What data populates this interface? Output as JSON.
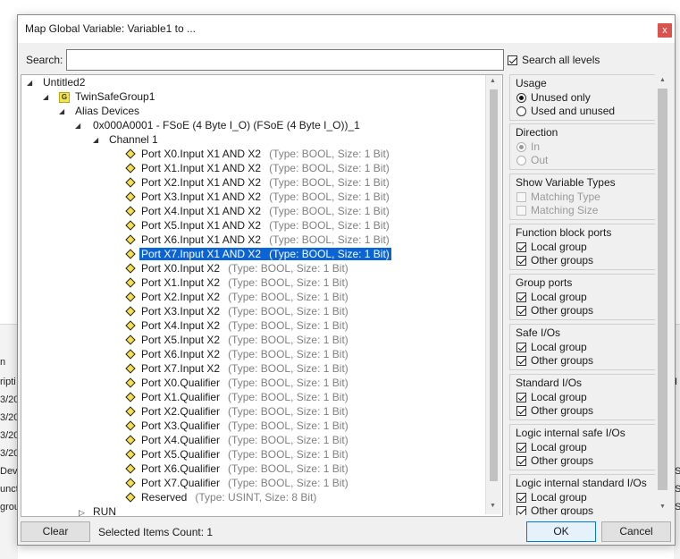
{
  "dialog": {
    "title": "Map Global Variable: Variable1 to ...",
    "close_glyph": "x",
    "search_label": "Search:",
    "search_value": "",
    "search_all_label": "Search all levels",
    "search_all_checked": true,
    "selected_count_label": "Selected Items Count: 1",
    "clear_label": "Clear",
    "ok_label": "OK",
    "cancel_label": "Cancel"
  },
  "tree": {
    "root": "Untitled2",
    "group": "TwinSafeGroup1",
    "group_icon_letter": "G",
    "alias": "Alias Devices",
    "device": "0x000A0001 - FSoE (4 Byte I_O) (FSoE (4 Byte I_O))_1",
    "channel": "Channel 1",
    "ports": [
      {
        "name": "Port X0.Input X1 AND X2",
        "type": "(Type: BOOL, Size: 1 Bit)"
      },
      {
        "name": "Port X1.Input X1 AND X2",
        "type": "(Type: BOOL, Size: 1 Bit)"
      },
      {
        "name": "Port X2.Input X1 AND X2",
        "type": "(Type: BOOL, Size: 1 Bit)"
      },
      {
        "name": "Port X3.Input X1 AND X2",
        "type": "(Type: BOOL, Size: 1 Bit)"
      },
      {
        "name": "Port X4.Input X1 AND X2",
        "type": "(Type: BOOL, Size: 1 Bit)"
      },
      {
        "name": "Port X5.Input X1 AND X2",
        "type": "(Type: BOOL, Size: 1 Bit)"
      },
      {
        "name": "Port X6.Input X1 AND X2",
        "type": "(Type: BOOL, Size: 1 Bit)"
      },
      {
        "name": "Port X7.Input X1 AND X2",
        "type": "(Type: BOOL, Size: 1 Bit)",
        "selected": true
      },
      {
        "name": "Port X0.Input X2",
        "type": "(Type: BOOL, Size: 1 Bit)"
      },
      {
        "name": "Port X1.Input X2",
        "type": "(Type: BOOL, Size: 1 Bit)"
      },
      {
        "name": "Port X2.Input X2",
        "type": "(Type: BOOL, Size: 1 Bit)"
      },
      {
        "name": "Port X3.Input X2",
        "type": "(Type: BOOL, Size: 1 Bit)"
      },
      {
        "name": "Port X4.Input X2",
        "type": "(Type: BOOL, Size: 1 Bit)"
      },
      {
        "name": "Port X5.Input X2",
        "type": "(Type: BOOL, Size: 1 Bit)"
      },
      {
        "name": "Port X6.Input X2",
        "type": "(Type: BOOL, Size: 1 Bit)"
      },
      {
        "name": "Port X7.Input X2",
        "type": "(Type: BOOL, Size: 1 Bit)"
      },
      {
        "name": "Port X0.Qualifier",
        "type": "(Type: BOOL, Size: 1 Bit)"
      },
      {
        "name": "Port X1.Qualifier",
        "type": "(Type: BOOL, Size: 1 Bit)"
      },
      {
        "name": "Port X2.Qualifier",
        "type": "(Type: BOOL, Size: 1 Bit)"
      },
      {
        "name": "Port X3.Qualifier",
        "type": "(Type: BOOL, Size: 1 Bit)"
      },
      {
        "name": "Port X4.Qualifier",
        "type": "(Type: BOOL, Size: 1 Bit)"
      },
      {
        "name": "Port X5.Qualifier",
        "type": "(Type: BOOL, Size: 1 Bit)"
      },
      {
        "name": "Port X6.Qualifier",
        "type": "(Type: BOOL, Size: 1 Bit)"
      },
      {
        "name": "Port X7.Qualifier",
        "type": "(Type: BOOL, Size: 1 Bit)"
      },
      {
        "name": "Reserved",
        "type": "(Type: USINT, Size: 8 Bit)"
      }
    ],
    "run": "RUN"
  },
  "options": {
    "usage": {
      "title": "Usage",
      "unused_only": "Unused only",
      "used_and_unused": "Used and unused",
      "selected": "unused_only"
    },
    "direction": {
      "title": "Direction",
      "in": "In",
      "out": "Out",
      "selected": "in"
    },
    "show_types": {
      "title": "Show Variable Types",
      "matching_type": "Matching Type",
      "matching_size": "Matching Size"
    },
    "function_block_ports": {
      "title": "Function block ports",
      "local": "Local group",
      "other": "Other groups"
    },
    "group_ports": {
      "title": "Group ports",
      "local": "Local group",
      "other": "Other groups"
    },
    "safe_ios": {
      "title": "Safe I/Os",
      "local": "Local group",
      "other": "Other groups"
    },
    "standard_ios": {
      "title": "Standard I/Os",
      "local": "Local group",
      "other": "Other groups"
    },
    "logic_safe": {
      "title": "Logic internal safe I/Os",
      "local": "Local group",
      "other": "Other groups"
    },
    "logic_standard": {
      "title": "Logic internal standard I/Os",
      "local": "Local group",
      "other": "Other groups"
    }
  },
  "background": {
    "left_texts": [
      "n",
      "ripti",
      "3/20",
      "3/20",
      "3/20",
      "3/20",
      "Dev",
      "unct",
      "grou"
    ],
    "right_texts": [
      "I",
      "S",
      "S",
      "S"
    ]
  },
  "colors": {
    "selection": "#0a64d6",
    "close_button": "#d9534f",
    "icon_yellow": "#f2e350"
  }
}
